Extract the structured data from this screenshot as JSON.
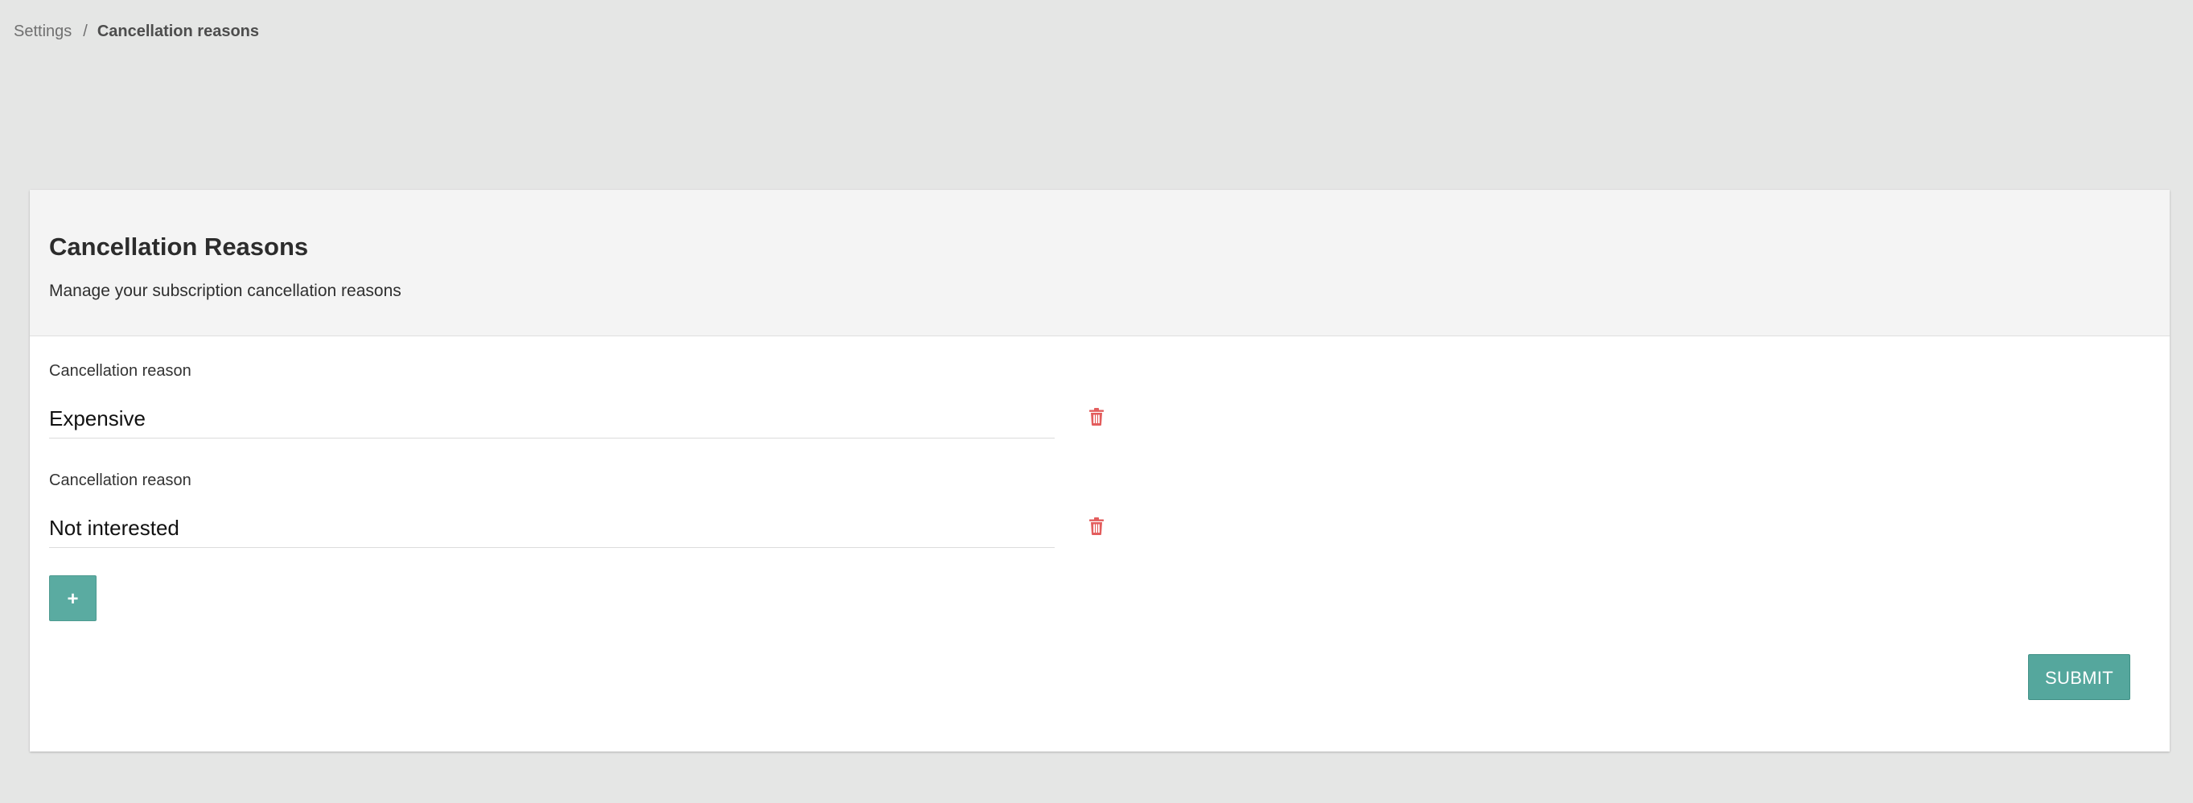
{
  "breadcrumb": {
    "items": [
      {
        "label": "Settings"
      },
      {
        "label": "Cancellation reasons"
      }
    ],
    "separator": "/"
  },
  "card": {
    "title": "Cancellation Reasons",
    "subtitle": "Manage your subscription cancellation reasons"
  },
  "reasons": [
    {
      "label": "Cancellation reason",
      "value": "Expensive",
      "delete_icon": "trash-icon"
    },
    {
      "label": "Cancellation reason",
      "value": "Not interested",
      "delete_icon": "trash-icon"
    }
  ],
  "actions": {
    "add_label": "+",
    "submit_label": "SUBMIT"
  },
  "colors": {
    "page_background": "#e5e6e5",
    "accent": "#55a79d",
    "delete": "#e35d5d"
  }
}
